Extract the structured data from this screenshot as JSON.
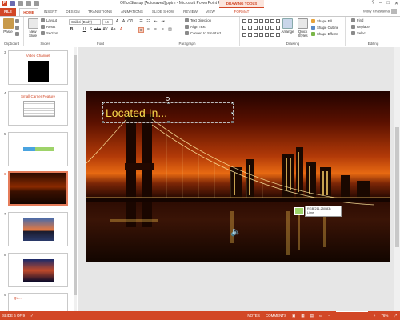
{
  "window": {
    "title": "OfficeStartup [Autosaved].pptm - Microsoft PowerPoint Preview",
    "context_tab_group": "DRAWING TOOLS",
    "controls": [
      "?",
      "–",
      "□",
      "✕"
    ]
  },
  "qat": [
    "save",
    "undo",
    "redo",
    "start-from-beginning",
    "customize"
  ],
  "tabs": [
    "FILE",
    "HOME",
    "INSERT",
    "DESIGN",
    "TRANSITIONS",
    "ANIMATIONS",
    "SLIDE SHOW",
    "REVIEW",
    "VIEW",
    "FORMAT"
  ],
  "active_tab": "HOME",
  "user": "Molly Chastalina",
  "ribbon": {
    "clipboard": {
      "label": "Clipboard",
      "paste": "Paste"
    },
    "slides": {
      "label": "Slides",
      "new_slide": "New Slide",
      "layout": "Layout",
      "reset": "Reset",
      "section": "Section"
    },
    "font": {
      "label": "Font",
      "family": "Calibri (Body)",
      "size": "14"
    },
    "paragraph": {
      "label": "Paragraph",
      "text_direction": "Text Direction",
      "align_text": "Align Text",
      "convert": "Convert to SmartArt"
    },
    "drawing": {
      "label": "Drawing",
      "arrange": "Arrange",
      "quick_styles": "Quick Styles",
      "shape_fill": "Shape Fill",
      "shape_outline": "Shape Outline",
      "shape_effects": "Shape Effects"
    },
    "editing": {
      "label": "Editing",
      "find": "Find",
      "replace": "Replace",
      "select": "Select"
    }
  },
  "thumbnails": [
    {
      "num": "3",
      "caption": "Video Channel"
    },
    {
      "num": "4",
      "caption": "Small Carrier Feature"
    },
    {
      "num": "5",
      "caption": ""
    },
    {
      "num": "6",
      "caption": ""
    },
    {
      "num": "7",
      "caption": ""
    },
    {
      "num": "8",
      "caption": ""
    },
    {
      "num": "9",
      "caption": "Qu..."
    }
  ],
  "slide": {
    "title": "Located In...",
    "tooltip_line1": "RGB(211,250,83)",
    "tooltip_line2": "Lime"
  },
  "status": {
    "slide_indicator": "SLIDE 6 OF 9",
    "language": "✓",
    "notes": "NOTES",
    "comments": "COMMENTS",
    "zoom": "76%"
  },
  "colors": {
    "accent": "#d24726",
    "title_text": "#f6d64a",
    "lime": "#9ed36a"
  }
}
